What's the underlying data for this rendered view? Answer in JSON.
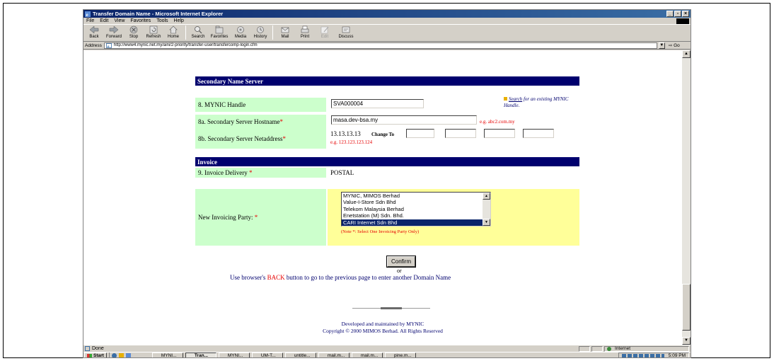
{
  "window": {
    "title": "Transfer Domain Name - Microsoft Internet Explorer"
  },
  "menu": [
    "File",
    "Edit",
    "View",
    "Favorites",
    "Tools",
    "Help"
  ],
  "toolbar": {
    "back": "Back",
    "forward": "Forward",
    "stop": "Stop",
    "refresh": "Refresh",
    "home": "Home",
    "search": "Search",
    "favorites": "Favorites",
    "media": "Media",
    "history": "History",
    "mail": "Mail",
    "print": "Print",
    "edit": "Edit",
    "discuss": "Discuss"
  },
  "address": {
    "label": "Address",
    "url": "http://www4.mynic.net.my/aini/2-priority/transfer-user/transfercomp-login.cfm",
    "go": "Go"
  },
  "form": {
    "secondary_header": "Secondary Name Server",
    "mynic_handle_label": "8. MYNIC Handle",
    "mynic_handle_value": "SVA000004",
    "search_link": "Search",
    "search_hint_rest": " for an existing MYNIC Handle.",
    "hostname_label": "8a. Secondary Server Hostname",
    "hostname_value": "masa.dev-bsa.my",
    "hostname_hint": "e.g. abc2.com.my",
    "netaddress_label": "8b. Secondary Server Netaddress",
    "netaddress_value": "13.13.13.13",
    "change_to": "Change To",
    "netaddress_hint": "e.g. 123.123.123.124",
    "required_mark": "*",
    "invoice_header": "Invoice",
    "invoice_delivery_label": "9. Invoice Delivery",
    "invoice_delivery_value": "POSTAL",
    "invoicing_party_label": "New Invoicing Party:",
    "invoicing_party_options": [
      "MYNIC, MIMOS Berhad",
      "Value-I-Store Sdn Bhd",
      "Telekom Malaysia Berhad",
      "Enetstation (M) Sdn. Bhd.",
      "CARI Internet Sdn Bhd"
    ],
    "invoicing_party_selected": "CARI Internet Sdn Bhd",
    "invoicing_note": "(Note *: Select One Invoicing Party Only)",
    "confirm_label": "Confirm",
    "or_text": "or",
    "back_text_1": "Use browser's ",
    "back_text_key": "BACK",
    "back_text_2": " button to go to the previous page to enter another Domain Name"
  },
  "footer": {
    "developed": "Developed and maintained by MYNIC",
    "copyright": "Copyright © 2000 MIMOS Berhad. All Rights Reserved"
  },
  "status": {
    "left": "Done",
    "zone": "Internet"
  },
  "taskbar": {
    "start": "Start",
    "tasks": [
      "MYNI...",
      "Tran...",
      "MYNI...",
      "UM-T...",
      "untitle...",
      "mail.m...",
      "mail.m...",
      "pine.m..."
    ],
    "active_index": 1,
    "clock": "5:09 PM"
  },
  "colors": {
    "section_bar": "#00006e",
    "label_green": "#ccffcc",
    "select_yellow": "#ffff99",
    "required_red": "#e60000"
  }
}
